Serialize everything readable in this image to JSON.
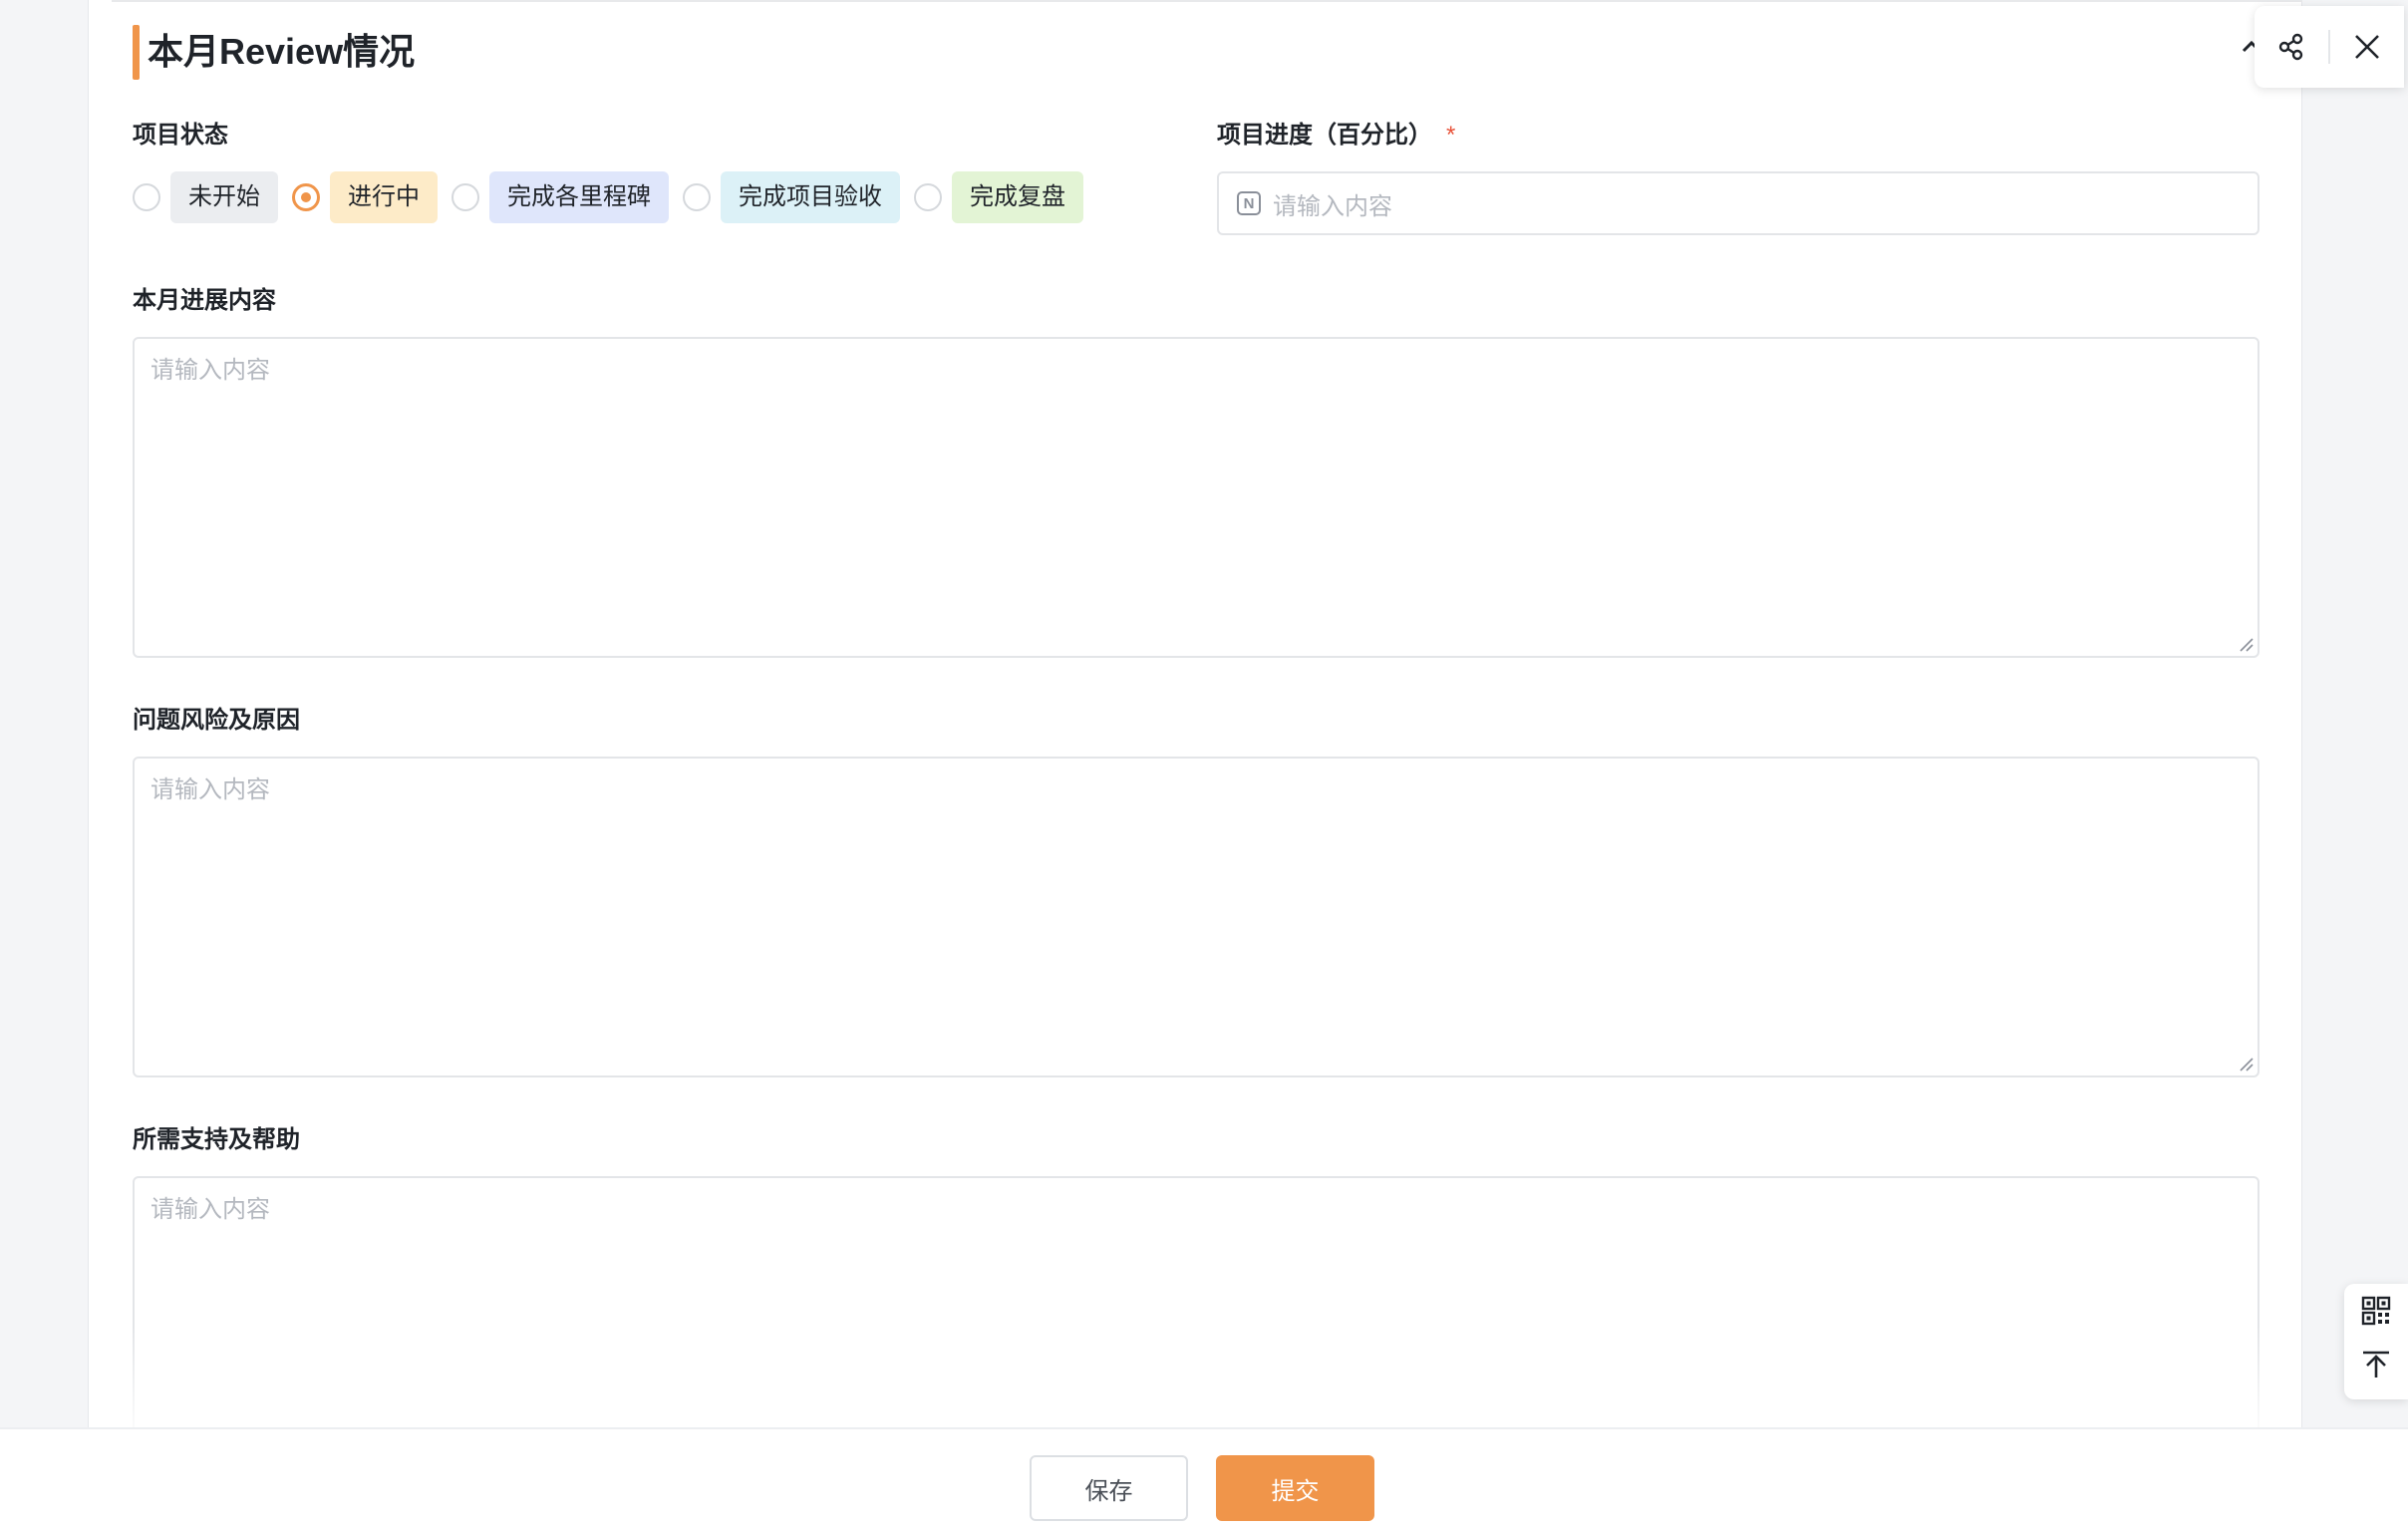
{
  "section": {
    "title": "本月Review情况"
  },
  "project_status": {
    "label": "项目状态",
    "selected": "进行中",
    "options": [
      {
        "label": "未开始",
        "bg": "#ebedf0",
        "color": "#1f2329",
        "checked": false
      },
      {
        "label": "进行中",
        "bg": "#fdebc8",
        "color": "#1f2329",
        "checked": true
      },
      {
        "label": "完成各里程碑",
        "bg": "#dfe6fb",
        "color": "#1f2329",
        "checked": false
      },
      {
        "label": "完成项目验收",
        "bg": "#dcf1f7",
        "color": "#1f2329",
        "checked": false
      },
      {
        "label": "完成复盘",
        "bg": "#e3f4d5",
        "color": "#1f2329",
        "checked": false
      }
    ]
  },
  "project_progress": {
    "label": "项目进度（百分比）",
    "required_mark": "*",
    "placeholder": "请输入内容",
    "icon": "number-input-icon"
  },
  "monthly_progress": {
    "label": "本月进展内容",
    "placeholder": "请输入内容"
  },
  "issues_risks": {
    "label": "问题风险及原因",
    "placeholder": "请输入内容"
  },
  "support_needed": {
    "label": "所需支持及帮助",
    "placeholder": "请输入内容"
  },
  "toolbar": {
    "share_icon": "share-icon",
    "close_icon": "close-icon"
  },
  "side_tools": {
    "qr_icon": "qr-code-icon",
    "top_icon": "back-to-top-icon"
  },
  "footer": {
    "save_label": "保存",
    "submit_label": "提交"
  },
  "colors": {
    "accent": "#f0954a",
    "required": "#e8533a"
  }
}
